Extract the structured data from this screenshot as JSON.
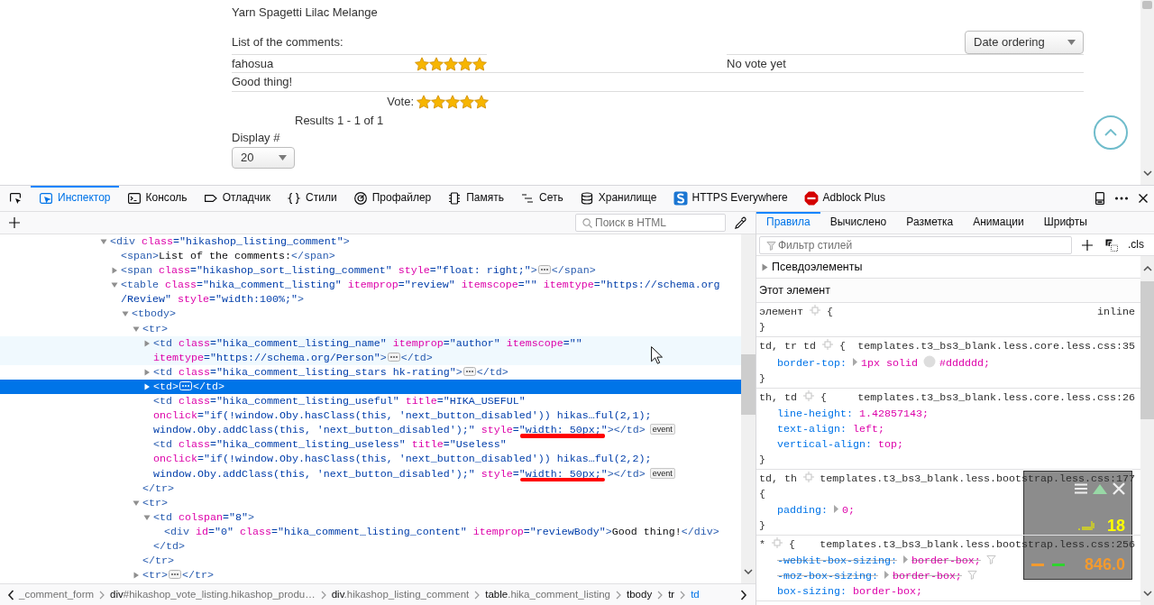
{
  "page": {
    "product_title": "Yarn Spagetti Lilac Melange",
    "comments_label": "List of the comments:",
    "sort_select": {
      "value": "Date ordering"
    },
    "comments": [
      {
        "author": "fahosua",
        "stars": 5,
        "vote_status": "No vote yet",
        "body": "Good thing!"
      }
    ],
    "vote": {
      "label": "Vote:",
      "stars": 5
    },
    "results": "Results 1 - 1 of 1",
    "display_label": "Display #",
    "display_select": {
      "value": "20"
    }
  },
  "devtools": {
    "tabs": [
      {
        "label": "Инспектор",
        "selected": true
      },
      {
        "label": "Консоль",
        "selected": false
      },
      {
        "label": "Отладчик",
        "selected": false
      },
      {
        "label": "Стили",
        "selected": false
      },
      {
        "label": "Профайлер",
        "selected": false
      },
      {
        "label": "Память",
        "selected": false
      },
      {
        "label": "Сеть",
        "selected": false
      },
      {
        "label": "Хранилище",
        "selected": false
      },
      {
        "label": "HTTPS Everywhere",
        "selected": false
      },
      {
        "label": "Adblock Plus",
        "selected": false
      }
    ],
    "markup_search": {
      "placeholder": "Поиск в HTML"
    },
    "markup_tree": [
      {
        "expanded": true,
        "selected": false,
        "hovered": false,
        "lines": [
          [
            {
              "kind": "tag",
              "text": "<div"
            },
            {
              "kind": "attr",
              "text": " class"
            },
            {
              "kind": "value",
              "text": "=\"hikashop_listing_comment\""
            },
            {
              "kind": "tag",
              "text": ">"
            }
          ]
        ],
        "children": [
          {
            "selected": false,
            "hovered": false,
            "lines": [
              [
                {
                  "kind": "tag",
                  "text": "<span>"
                },
                {
                  "kind": "text",
                  "text": "List of the comments:"
                },
                {
                  "kind": "tag",
                  "text": "</span>"
                }
              ]
            ]
          },
          {
            "expanded": false,
            "selected": false,
            "hovered": false,
            "lines": [
              [
                {
                  "kind": "tag",
                  "text": "<span"
                },
                {
                  "kind": "attr",
                  "text": " class"
                },
                {
                  "kind": "value",
                  "text": "=\"hikashop_sort_listing_comment\""
                },
                {
                  "kind": "attr",
                  "text": " style"
                },
                {
                  "kind": "value",
                  "text": "=\"float: right;\""
                },
                {
                  "kind": "tag",
                  "text": ">"
                },
                {
                  "kind": "more"
                },
                {
                  "kind": "tag",
                  "text": "</span>"
                }
              ]
            ]
          },
          {
            "expanded": true,
            "selected": false,
            "hovered": false,
            "lines": [
              [
                {
                  "kind": "tag",
                  "text": "<table"
                },
                {
                  "kind": "attr",
                  "text": " class"
                },
                {
                  "kind": "value",
                  "text": "=\"hika_comment_listing\""
                },
                {
                  "kind": "attr",
                  "text": " itemprop"
                },
                {
                  "kind": "value",
                  "text": "=\"review\""
                },
                {
                  "kind": "attr",
                  "text": " itemscope"
                },
                {
                  "kind": "value",
                  "text": "=\"\""
                },
                {
                  "kind": "attr",
                  "text": " itemtype"
                },
                {
                  "kind": "value",
                  "text": "=\"https://schema.org"
                }
              ],
              [
                {
                  "kind": "value",
                  "text": "/Review\""
                },
                {
                  "kind": "attr",
                  "text": " style"
                },
                {
                  "kind": "value",
                  "text": "=\"width:100%;\""
                },
                {
                  "kind": "tag",
                  "text": ">"
                }
              ]
            ],
            "children": [
              {
                "expanded": true,
                "selected": false,
                "hovered": false,
                "lines": [
                  [
                    {
                      "kind": "tag",
                      "text": "<tbody>"
                    }
                  ]
                ],
                "children": [
                  {
                    "expanded": true,
                    "selected": false,
                    "hovered": false,
                    "lines": [
                      [
                        {
                          "kind": "tag",
                          "text": "<tr>"
                        }
                      ]
                    ],
                    "close": [
                      {
                        "kind": "tag",
                        "text": "</tr>"
                      }
                    ],
                    "children": [
                      {
                        "expanded": false,
                        "selected": false,
                        "hovered": true,
                        "lines": [
                          [
                            {
                              "kind": "tag",
                              "text": "<td"
                            },
                            {
                              "kind": "attr",
                              "text": " class"
                            },
                            {
                              "kind": "value",
                              "text": "=\"hika_comment_listing_name\""
                            },
                            {
                              "kind": "attr",
                              "text": " itemprop"
                            },
                            {
                              "kind": "value",
                              "text": "=\"author\""
                            },
                            {
                              "kind": "attr",
                              "text": " itemscope"
                            },
                            {
                              "kind": "value",
                              "text": "=\"\""
                            }
                          ],
                          [
                            {
                              "kind": "attr",
                              "text": "itemtype"
                            },
                            {
                              "kind": "value",
                              "text": "=\"https://schema.org/Person\""
                            },
                            {
                              "kind": "tag",
                              "text": ">"
                            },
                            {
                              "kind": "more"
                            },
                            {
                              "kind": "tag",
                              "text": "</td>"
                            }
                          ]
                        ]
                      },
                      {
                        "expanded": false,
                        "selected": false,
                        "hovered": false,
                        "lines": [
                          [
                            {
                              "kind": "tag",
                              "text": "<td"
                            },
                            {
                              "kind": "attr",
                              "text": " class"
                            },
                            {
                              "kind": "value",
                              "text": "=\"hika_comment_listing_stars hk-rating\""
                            },
                            {
                              "kind": "tag",
                              "text": ">"
                            },
                            {
                              "kind": "more"
                            },
                            {
                              "kind": "tag",
                              "text": "</td>"
                            }
                          ]
                        ]
                      },
                      {
                        "expanded": false,
                        "selected": true,
                        "hovered": false,
                        "lines": [
                          [
                            {
                              "kind": "tag",
                              "text": "<td>"
                            },
                            {
                              "kind": "more"
                            },
                            {
                              "kind": "tag",
                              "text": "</td>"
                            }
                          ]
                        ]
                      },
                      {
                        "selected": false,
                        "hovered": false,
                        "lines": [
                          [
                            {
                              "kind": "tag",
                              "text": "<td"
                            },
                            {
                              "kind": "attr",
                              "text": " class"
                            },
                            {
                              "kind": "value",
                              "text": "=\"hika_comment_listing_useful\""
                            },
                            {
                              "kind": "attr",
                              "text": " title"
                            },
                            {
                              "kind": "value",
                              "text": "=\"HIKA_USEFUL\""
                            }
                          ],
                          [
                            {
                              "kind": "attr",
                              "text": "onclick"
                            },
                            {
                              "kind": "value",
                              "text": "=\"if(!window.Oby.hasClass(this, 'next_button_disabled')) hikas…ful(2,1);"
                            }
                          ],
                          [
                            {
                              "kind": "value",
                              "text": "window.Oby.addClass(this, 'next_button_disabled');\""
                            },
                            {
                              "kind": "attr",
                              "text": " style"
                            },
                            {
                              "kind": "value",
                              "text": "=\""
                            },
                            {
                              "kind": "annotated_value",
                              "text": "width: 50px;"
                            },
                            {
                              "kind": "value",
                              "text": "\""
                            },
                            {
                              "kind": "tag",
                              "text": "></td>"
                            },
                            {
                              "kind": "event",
                              "text": "event"
                            }
                          ]
                        ]
                      },
                      {
                        "selected": false,
                        "hovered": false,
                        "lines": [
                          [
                            {
                              "kind": "tag",
                              "text": "<td"
                            },
                            {
                              "kind": "attr",
                              "text": " class"
                            },
                            {
                              "kind": "value",
                              "text": "=\"hika_comment_listing_useless\""
                            },
                            {
                              "kind": "attr",
                              "text": " title"
                            },
                            {
                              "kind": "value",
                              "text": "=\"Useless\""
                            }
                          ],
                          [
                            {
                              "kind": "attr",
                              "text": "onclick"
                            },
                            {
                              "kind": "value",
                              "text": "=\"if(!window.Oby.hasClass(this, 'next_button_disabled')) hikas…ful(2,2);"
                            }
                          ],
                          [
                            {
                              "kind": "value",
                              "text": "window.Oby.addClass(this, 'next_button_disabled');\""
                            },
                            {
                              "kind": "attr",
                              "text": " style"
                            },
                            {
                              "kind": "value",
                              "text": "=\""
                            },
                            {
                              "kind": "annotated_value",
                              "text": "width: 50px;"
                            },
                            {
                              "kind": "value",
                              "text": "\""
                            },
                            {
                              "kind": "tag",
                              "text": "></td>"
                            },
                            {
                              "kind": "event",
                              "text": "event"
                            }
                          ]
                        ]
                      }
                    ]
                  },
                  {
                    "expanded": true,
                    "selected": false,
                    "hovered": false,
                    "lines": [
                      [
                        {
                          "kind": "tag",
                          "text": "<tr>"
                        }
                      ]
                    ],
                    "close": [
                      {
                        "kind": "tag",
                        "text": "</tr>"
                      }
                    ],
                    "children": [
                      {
                        "expanded": true,
                        "selected": false,
                        "hovered": false,
                        "lines": [
                          [
                            {
                              "kind": "tag",
                              "text": "<td"
                            },
                            {
                              "kind": "attr",
                              "text": " colspan"
                            },
                            {
                              "kind": "value",
                              "text": "=\"8\""
                            },
                            {
                              "kind": "tag",
                              "text": ">"
                            }
                          ]
                        ],
                        "close": [
                          {
                            "kind": "tag",
                            "text": "</td>"
                          }
                        ],
                        "children": [
                          {
                            "selected": false,
                            "hovered": false,
                            "lines": [
                              [
                                {
                                  "kind": "tag",
                                  "text": "<div"
                                },
                                {
                                  "kind": "attr",
                                  "text": " id"
                                },
                                {
                                  "kind": "value",
                                  "text": "=\"0\""
                                },
                                {
                                  "kind": "attr",
                                  "text": " class"
                                },
                                {
                                  "kind": "value",
                                  "text": "=\"hika_comment_listing_content\""
                                },
                                {
                                  "kind": "attr",
                                  "text": " itemprop"
                                },
                                {
                                  "kind": "value",
                                  "text": "=\"reviewBody\""
                                },
                                {
                                  "kind": "tag",
                                  "text": ">"
                                },
                                {
                                  "kind": "text",
                                  "text": "Good thing!"
                                },
                                {
                                  "kind": "tag",
                                  "text": "</div>"
                                }
                              ]
                            ]
                          }
                        ]
                      }
                    ]
                  },
                  {
                    "expanded": false,
                    "selected": false,
                    "hovered": false,
                    "lines": [
                      [
                        {
                          "kind": "tag",
                          "text": "<tr>"
                        },
                        {
                          "kind": "more"
                        },
                        {
                          "kind": "tag",
                          "text": "</tr>"
                        }
                      ]
                    ]
                  }
                ]
              }
            ]
          }
        ]
      }
    ],
    "breadcrumbs": [
      {
        "detail": "_comment_form",
        "selected": false
      },
      {
        "tag": "div",
        "detail": "#hikashop_vote_listing.hikashop_produ…",
        "selected": false
      },
      {
        "tag": "div",
        "detail": ".hikashop_listing_comment",
        "selected": false
      },
      {
        "tag": "table",
        "detail": ".hika_comment_listing",
        "selected": false
      },
      {
        "tag": "tbody",
        "selected": false
      },
      {
        "tag": "tr",
        "selected": false
      },
      {
        "tag": "td",
        "selected": true
      }
    ],
    "sidebar_tabs": [
      {
        "label": "Правила",
        "selected": true
      },
      {
        "label": "Вычислено",
        "selected": false
      },
      {
        "label": "Разметка",
        "selected": false
      },
      {
        "label": "Анимации",
        "selected": false
      },
      {
        "label": "Шрифты",
        "selected": false
      }
    ],
    "style_filter": {
      "placeholder": "Фильтр стилей"
    },
    "class_toggle": ".cls",
    "pseudo_elements": {
      "label": "Псевдоэлементы",
      "expanded": false
    },
    "element_section": "Этот элемент",
    "rules": [
      {
        "selector": "элемент",
        "open": "{",
        "source": "inline",
        "close": "}"
      },
      {
        "selector": "td, tr td",
        "open": "{",
        "source": "templates.t3_bs3_blank.less.core.less.css:35",
        "declarations": [
          {
            "property": "border-top:",
            "expandable": true,
            "overridden": false,
            "value": "1px solid",
            "color": "#dddddd",
            "color_value": "#dddddd;"
          }
        ],
        "close": "}"
      },
      {
        "selector": "th, td",
        "open": "{",
        "source": "templates.t3_bs3_blank.less.core.less.css:26",
        "declarations": [
          {
            "property": "line-height:",
            "expandable": false,
            "overridden": false,
            "value": "1.42857143;"
          },
          {
            "property": "text-align:",
            "expandable": false,
            "overridden": false,
            "value": "left;"
          },
          {
            "property": "vertical-align:",
            "expandable": false,
            "overridden": false,
            "value": "top;"
          }
        ],
        "close": "}"
      },
      {
        "selector": "td, th",
        "open": "{",
        "source": "templates.t3_bs3_blank.less.bootstrap.less.css:177",
        "declarations": [
          {
            "property": "padding:",
            "expandable": true,
            "overridden": false,
            "value": "0;"
          }
        ],
        "close": "}"
      },
      {
        "selector": "*",
        "open": "{",
        "source": "templates.t3_bs3_blank.less.bootstrap.less.css:256",
        "declarations": [
          {
            "property": "-webkit-box-sizing:",
            "expandable": true,
            "overridden": true,
            "value": "border-box;"
          },
          {
            "property": "-moz-box-sizing:",
            "expandable": true,
            "overridden": true,
            "value": "border-box;"
          },
          {
            "property": "box-sizing:",
            "expandable": false,
            "overridden": false,
            "value": "border-box;"
          }
        ]
      }
    ]
  },
  "meter_overlay": {
    "reading_1": "18",
    "reading_2": "846.0"
  }
}
